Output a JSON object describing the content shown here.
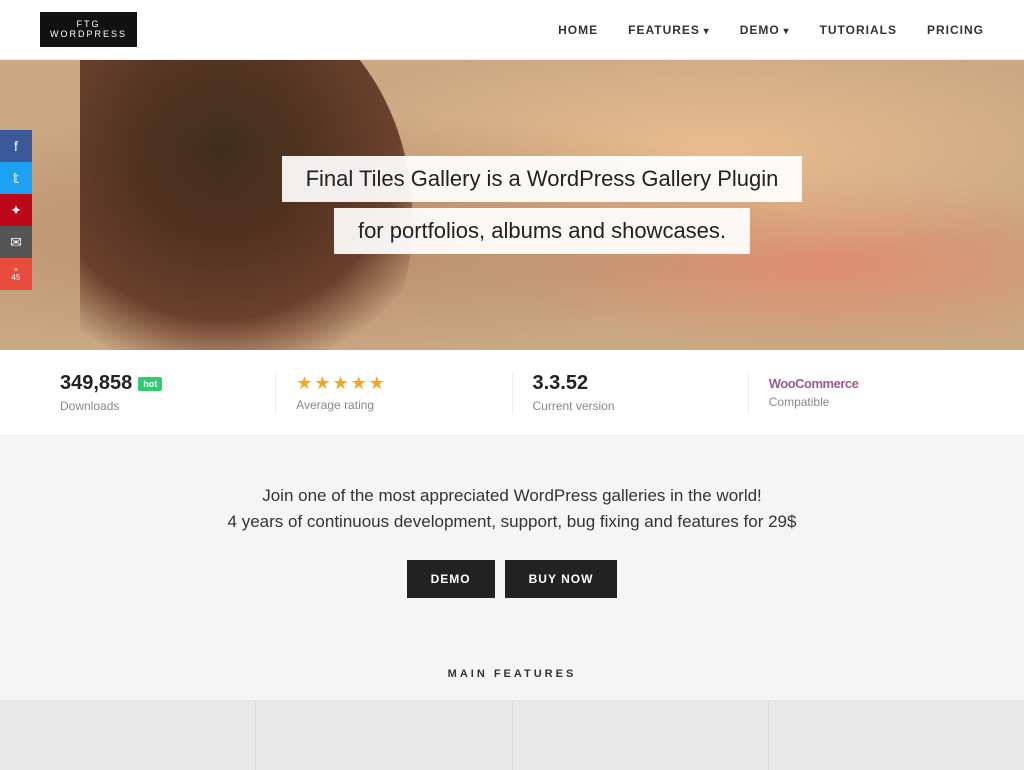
{
  "nav": {
    "logo_line1": "FTG",
    "logo_line2": "WORDPRESS",
    "links": [
      {
        "label": "HOME",
        "has_arrow": false
      },
      {
        "label": "FEATURES",
        "has_arrow": true
      },
      {
        "label": "DEMO",
        "has_arrow": true
      },
      {
        "label": "TUTORIALS",
        "has_arrow": false
      },
      {
        "label": "PRICING",
        "has_arrow": false
      }
    ]
  },
  "social": {
    "fb": "f",
    "tw": "t",
    "pr": "✦",
    "em": "✉",
    "plus_label": "+",
    "plus_count": "45"
  },
  "hero": {
    "line1": "Final Tiles Gallery is a WordPress Gallery Plugin",
    "line2": "for portfolios, albums and showcases."
  },
  "stats": {
    "downloads_value": "349,858",
    "downloads_hot": "hot",
    "downloads_label": "Downloads",
    "rating_stars": "★★★★★",
    "rating_label": "Average rating",
    "version_value": "3.3.52",
    "version_label": "Current version",
    "woo_label": "Compatible",
    "woo_text": "WooCommerce"
  },
  "promo": {
    "line1": "Join one of the most appreciated WordPress galleries in the world!",
    "line2": "4 years of continuous development, support, bug fixing and features for 29$",
    "btn_demo": "DEMO",
    "btn_buy": "BUY NOW"
  },
  "features": {
    "title": "MAIN FEATURES"
  }
}
